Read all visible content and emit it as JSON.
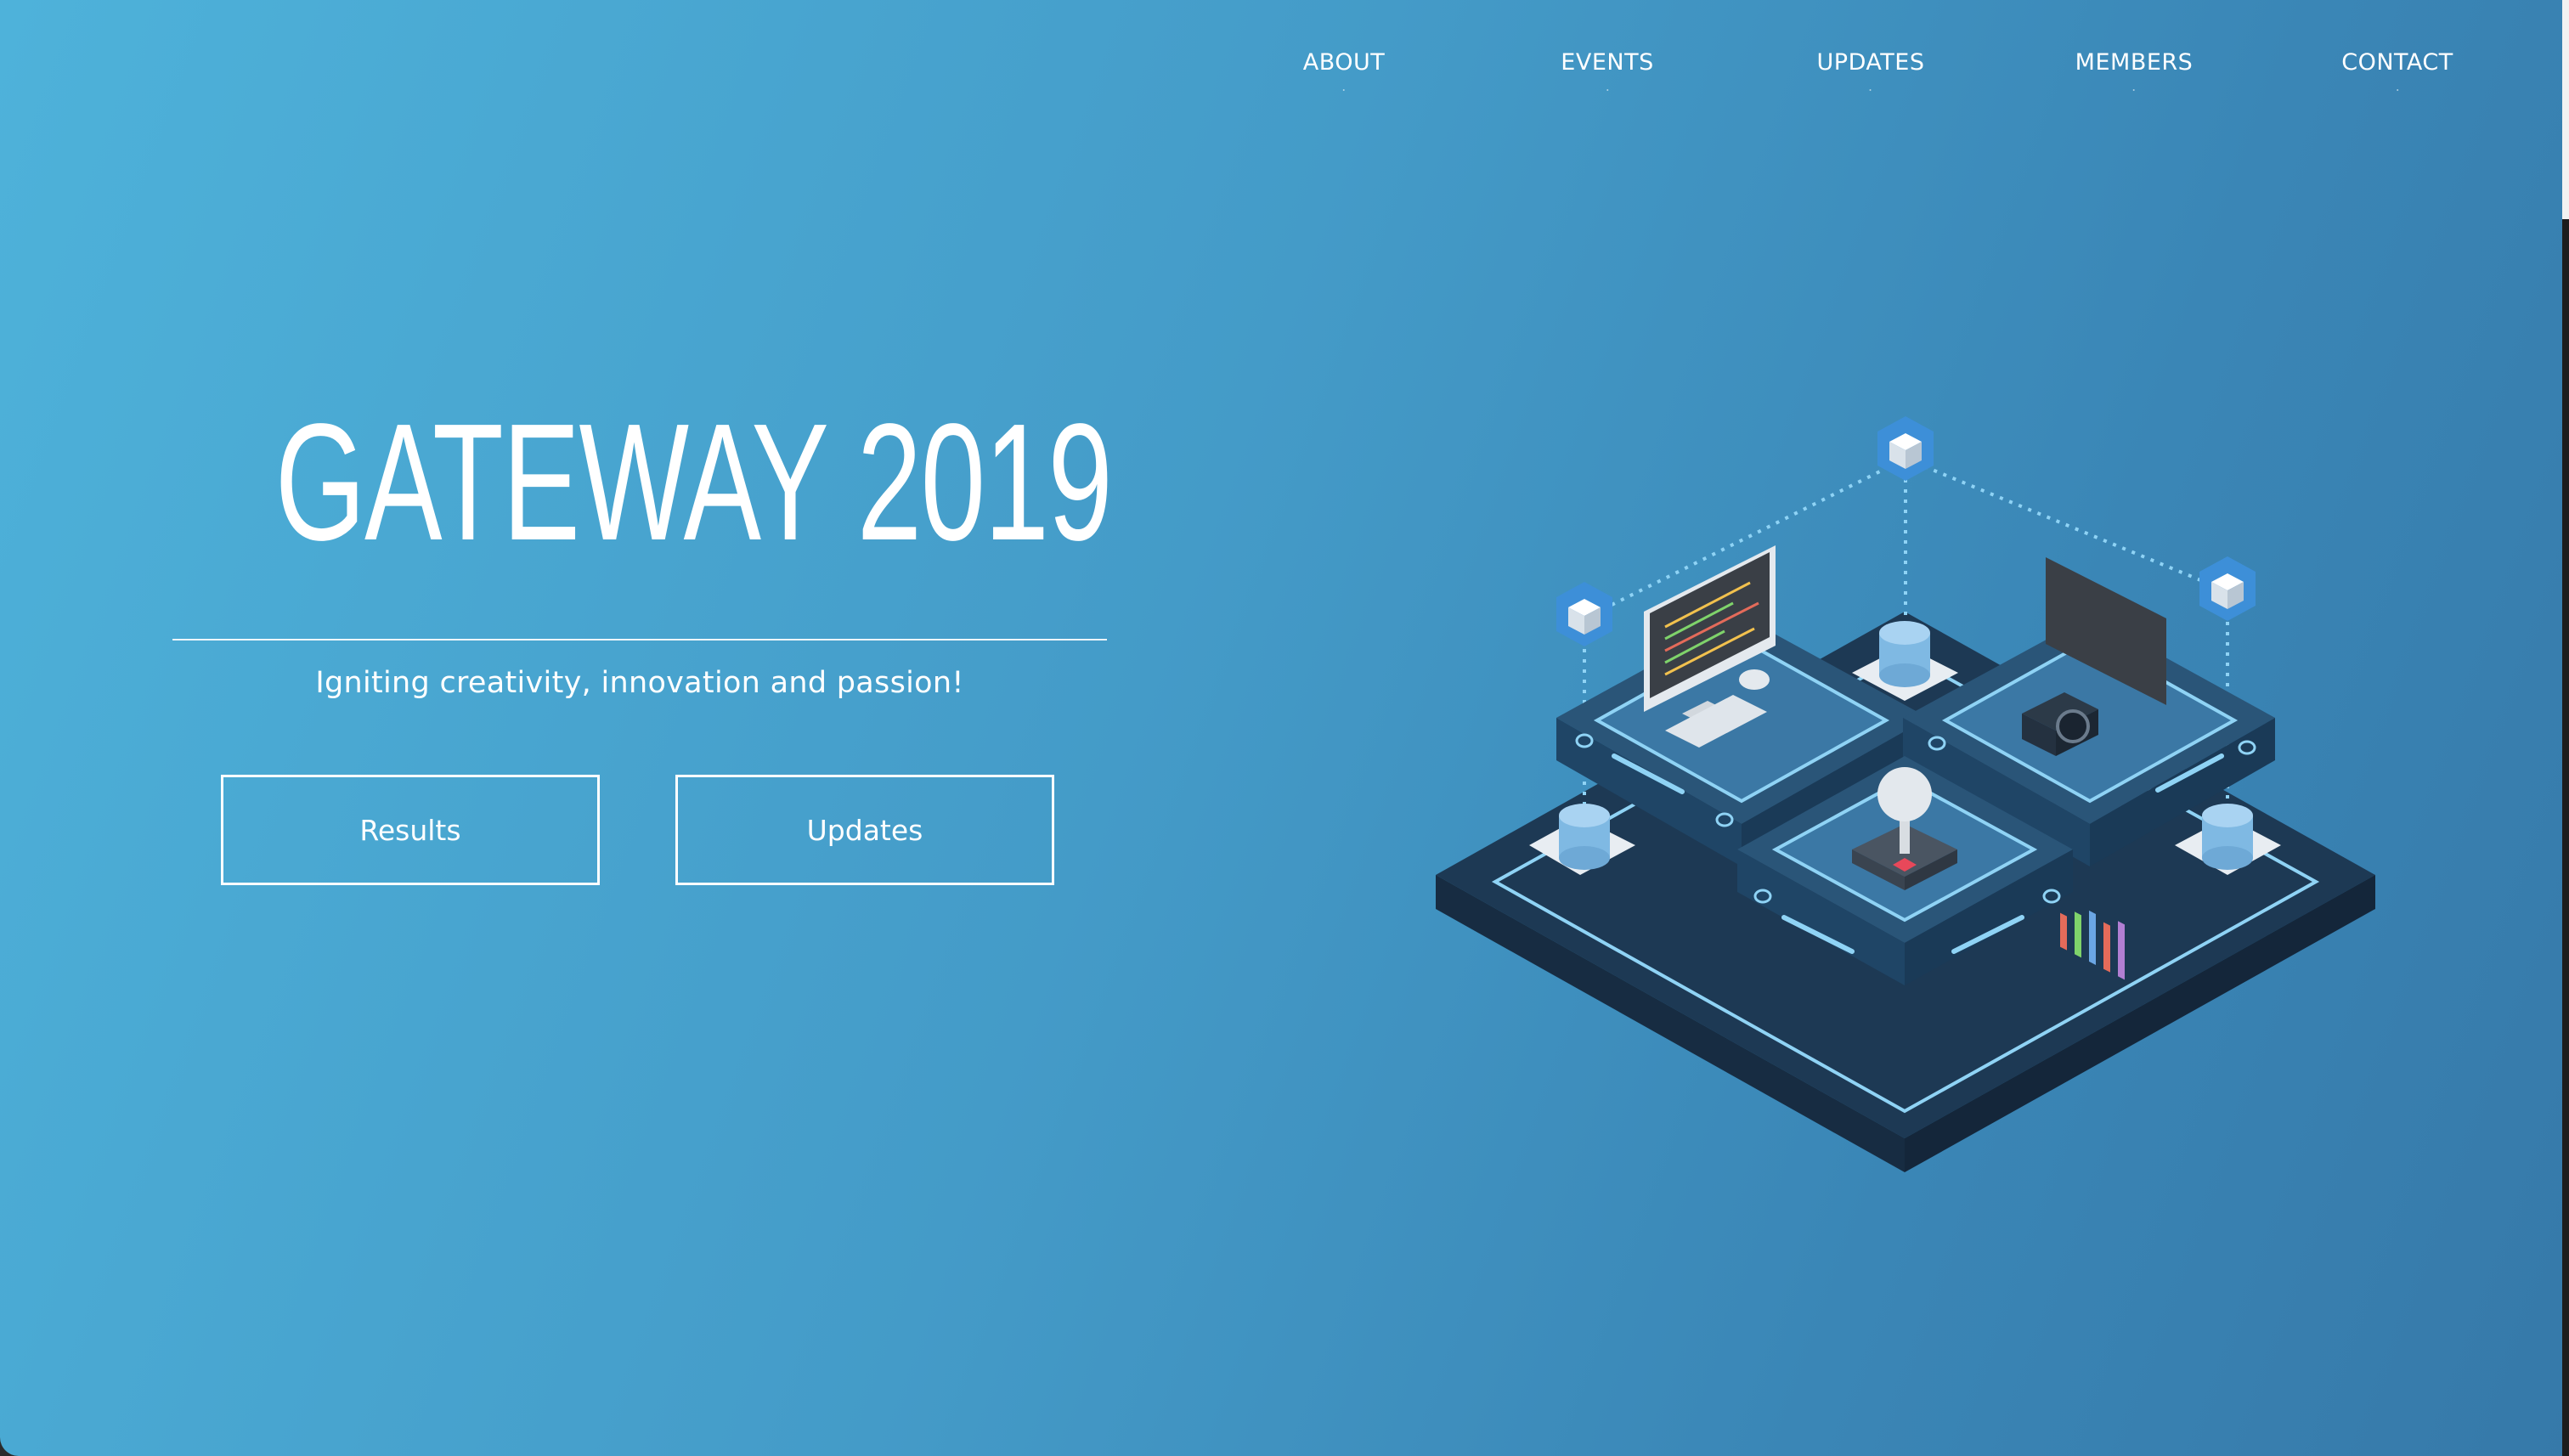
{
  "nav": {
    "items": [
      {
        "label": "ABOUT"
      },
      {
        "label": "EVENTS"
      },
      {
        "label": "UPDATES"
      },
      {
        "label": "MEMBERS"
      },
      {
        "label": "CONTACT"
      }
    ]
  },
  "hero": {
    "title": "GATEWAY 2019",
    "tagline": "Igniting creativity, innovation and passion!",
    "buttons": {
      "results_label": "Results",
      "updates_label": "Updates"
    }
  },
  "illustration": {
    "icon": "isometric-tech-platform-icon"
  },
  "colors": {
    "gradient_start": "#4eb2da",
    "gradient_end": "#3679a9",
    "text": "#ffffff",
    "platform_dark": "#1e3a55",
    "platform_mid": "#2a5578",
    "glow_line": "#8fd3f5"
  }
}
